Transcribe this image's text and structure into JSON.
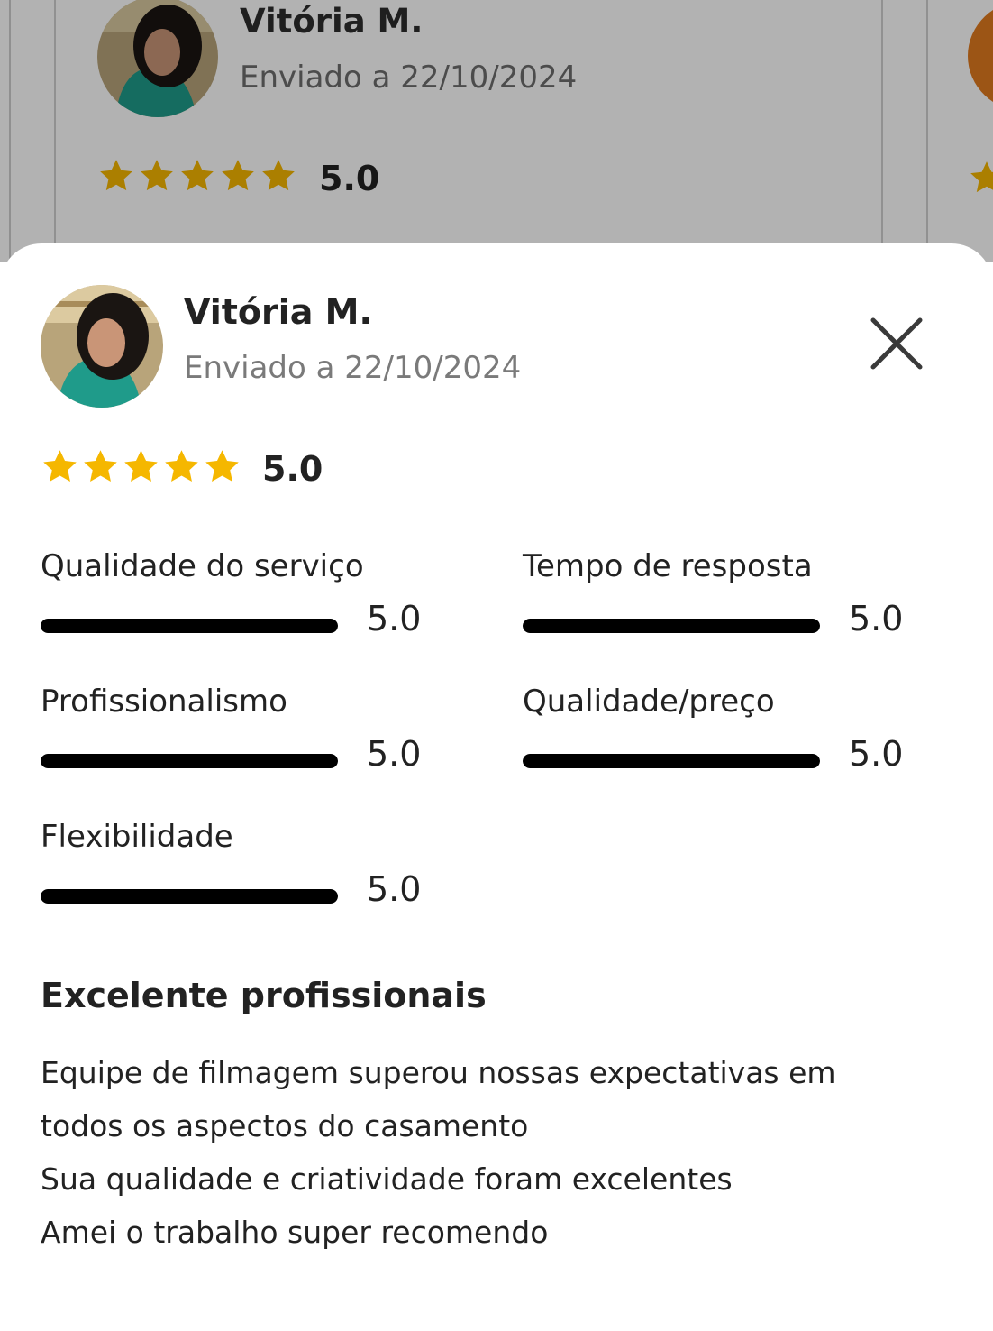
{
  "background_card": {
    "reviewer_name": "Vitória M.",
    "date": "Enviado a 22/10/2024",
    "score": "5.0",
    "stars": 5
  },
  "review": {
    "reviewer_name": "Vitória M.",
    "date": "Enviado a 22/10/2024",
    "overall_score": "5.0",
    "stars": 5,
    "close_icon": "close-icon",
    "ratings": [
      {
        "label": "Qualidade do serviço",
        "value": "5.0",
        "fraction": 1.0
      },
      {
        "label": "Tempo de resposta",
        "value": "5.0",
        "fraction": 1.0
      },
      {
        "label": "Profissionalismo",
        "value": "5.0",
        "fraction": 1.0
      },
      {
        "label": "Qualidade/preço",
        "value": "5.0",
        "fraction": 1.0
      },
      {
        "label": "Flexibilidade",
        "value": "5.0",
        "fraction": 1.0
      }
    ],
    "title": "Excelente profissionais",
    "body_lines": [
      "Equipe de filmagem superou nossas expectativas em",
      "todos os aspectos do casamento",
      "Sua qualidade e criatividade foram excelentes",
      "Amei o trabalho super recomendo"
    ]
  },
  "colors": {
    "star": "#f5b700",
    "bar_fill": "#000000",
    "accent_orange": "#e07a1f"
  }
}
